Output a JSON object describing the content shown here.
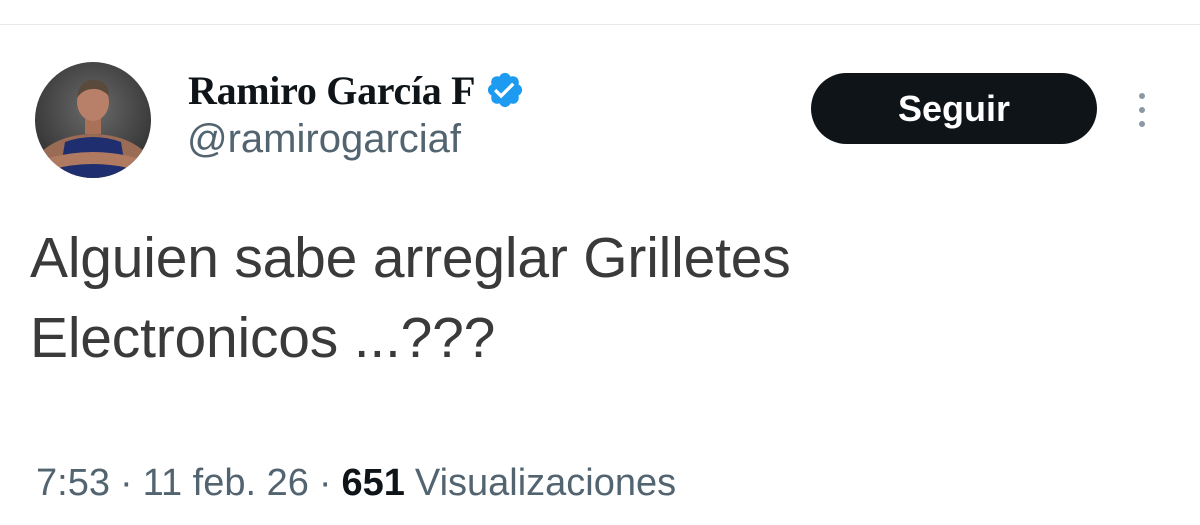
{
  "tweet": {
    "author": {
      "display_name": "Ramiro García F",
      "handle": "@ramirogarciaf",
      "verified": true,
      "verified_color": "#1d9bf0",
      "avatar_icon": "profile-photo"
    },
    "follow_label": "Seguir",
    "more_icon": "more-vertical-icon",
    "text_lines": [
      "Alguien sabe arreglar Grilletes",
      "Electronicos ...???"
    ],
    "meta": {
      "time": "7:53",
      "separator": "·",
      "date": "11 feb. 26",
      "views_count": "651",
      "views_label": "Visualizaciones"
    }
  },
  "colors": {
    "primary_text": "#0f1419",
    "secondary_text": "#536471",
    "button_bg": "#0f1419",
    "button_text": "#ffffff",
    "divider": "#e7e9ea"
  }
}
